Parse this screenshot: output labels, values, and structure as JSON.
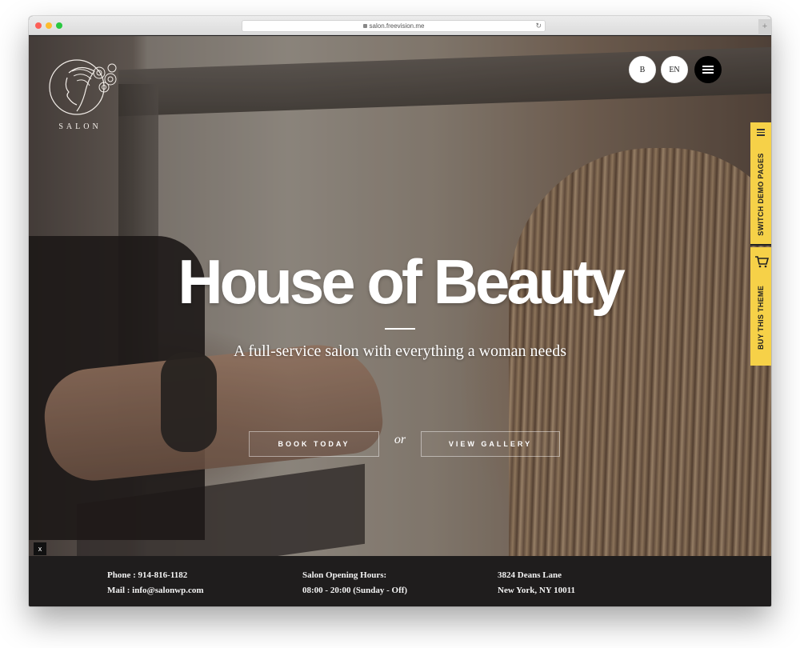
{
  "browser": {
    "url": "salon.freevision.me",
    "new_tab_label": "+",
    "reload_icon": "reload-icon"
  },
  "header": {
    "logo_text": "SALON",
    "buttons": {
      "b_label": "B",
      "lang_label": "EN",
      "menu_icon": "hamburger-icon"
    }
  },
  "side_panel": {
    "switch_label": "SWITCH DEMO PAGES",
    "buy_label": "BUY THIS THEME",
    "accent_color": "#f6d148"
  },
  "hero": {
    "title": "House of Beauty",
    "subtitle": "A full-service salon with everything a woman needs",
    "cta_primary": "BOOK TODAY",
    "cta_separator": "or",
    "cta_secondary": "VIEW GALLERY",
    "close_label": "x"
  },
  "footer": {
    "contact": {
      "phone": "Phone : 914-816-1182",
      "mail": "Mail : info@salonwp.com"
    },
    "hours": {
      "label": "Salon Opening Hours:",
      "value": "08:00 - 20:00 (Sunday - Off)"
    },
    "address": {
      "line1": "3824 Deans Lane",
      "line2": "New York, NY 10011"
    }
  }
}
